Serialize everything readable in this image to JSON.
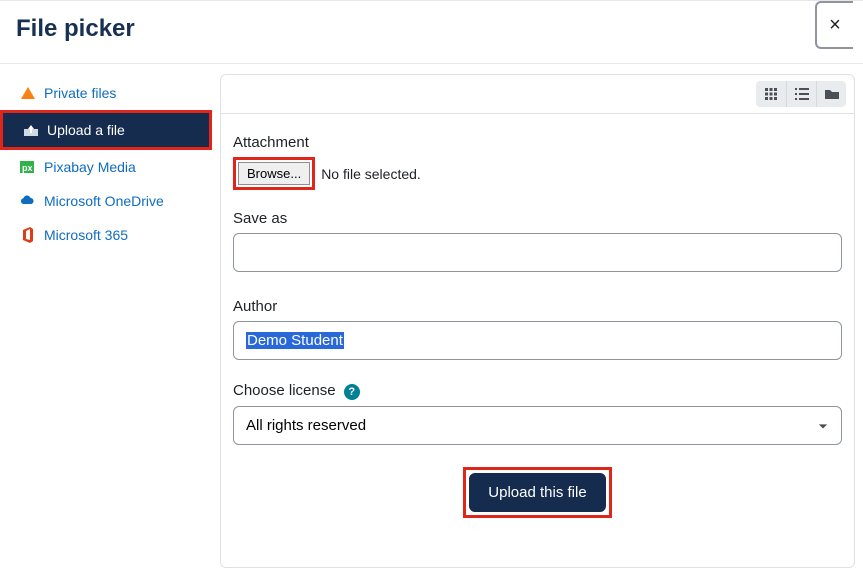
{
  "header": {
    "title": "File picker",
    "close": "×"
  },
  "sidebar": {
    "items": [
      {
        "label": "Private files"
      },
      {
        "label": "Upload a file"
      },
      {
        "label": "Pixabay Media"
      },
      {
        "label": "Microsoft OneDrive"
      },
      {
        "label": "Microsoft 365"
      }
    ]
  },
  "form": {
    "attachment_label": "Attachment",
    "browse_label": "Browse...",
    "no_file_text": "No file selected.",
    "saveas_label": "Save as",
    "saveas_value": "",
    "author_label": "Author",
    "author_value": "Demo Student",
    "license_label": "Choose license",
    "license_value": "All rights reserved",
    "help_icon": "?",
    "submit_label": "Upload this file"
  }
}
